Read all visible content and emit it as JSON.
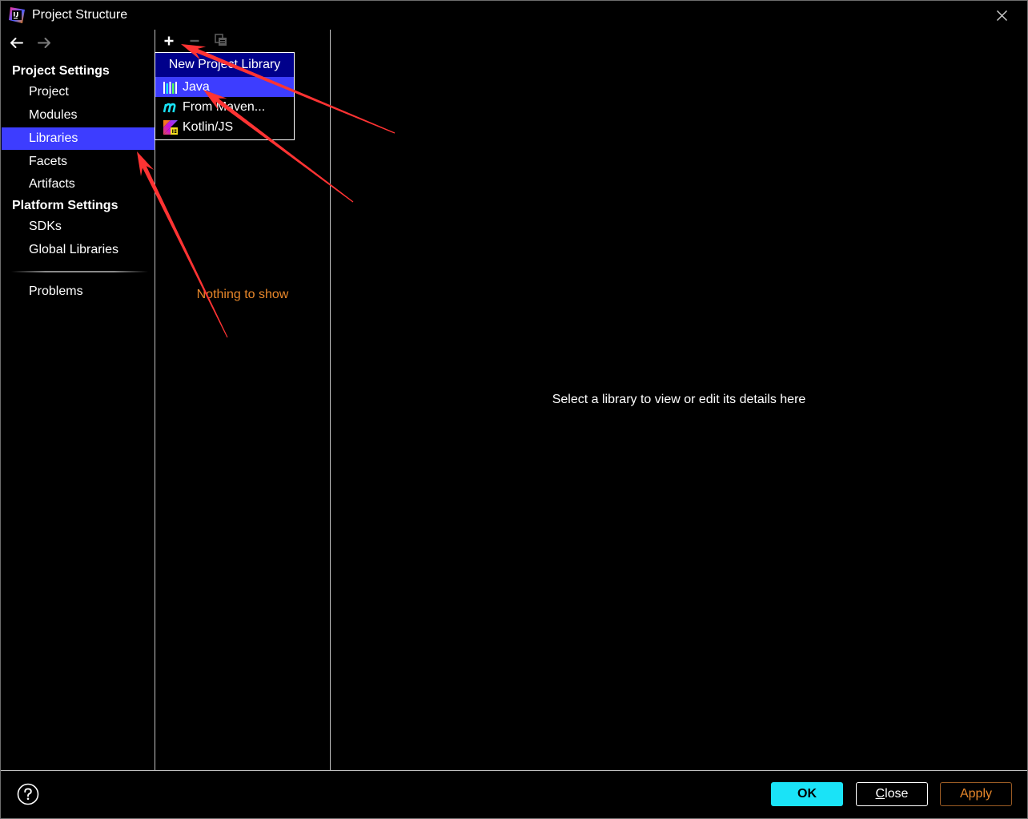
{
  "window": {
    "title": "Project Structure",
    "app_icon": "intellij-idea-icon",
    "close_icon": "close-icon"
  },
  "navigation": {
    "back_icon": "arrow-left-icon",
    "forward_icon": "arrow-right-icon",
    "back_enabled": true,
    "forward_enabled": false
  },
  "sidebar": {
    "project_settings": {
      "heading": "Project Settings",
      "items": [
        {
          "label": "Project",
          "selected": false
        },
        {
          "label": "Modules",
          "selected": false
        },
        {
          "label": "Libraries",
          "selected": true
        },
        {
          "label": "Facets",
          "selected": false
        },
        {
          "label": "Artifacts",
          "selected": false
        }
      ]
    },
    "platform_settings": {
      "heading": "Platform Settings",
      "items": [
        {
          "label": "SDKs",
          "selected": false
        },
        {
          "label": "Global Libraries",
          "selected": false
        }
      ]
    },
    "other_items": [
      {
        "label": "Problems",
        "selected": false
      }
    ]
  },
  "libraries_panel": {
    "toolbar": {
      "add_icon": "plus-icon",
      "remove_icon": "minus-icon",
      "copy_icon": "copy-icon",
      "add_enabled": true,
      "remove_enabled": false,
      "copy_enabled": false
    },
    "empty_text": "Nothing to show",
    "new_library_popup": {
      "header": "New Project Library",
      "items": [
        {
          "label": "Java",
          "icon": "library-icon",
          "selected": true
        },
        {
          "label": "From Maven...",
          "icon": "maven-icon",
          "selected": false
        },
        {
          "label": "Kotlin/JS",
          "icon": "kotlin-js-icon",
          "selected": false
        }
      ]
    }
  },
  "details_panel": {
    "placeholder": "Select a library to view or edit its details here"
  },
  "footer": {
    "help_icon": "help-icon",
    "ok_label": "OK",
    "close_label": "Close",
    "apply_label": "Apply"
  },
  "colors": {
    "background": "#000000",
    "text": "#ffffff",
    "selection": "#3d3dff",
    "popup_header": "#00008b",
    "empty_text": "#e8872a",
    "ok_button": "#1ae3f7",
    "apply_border": "#9a5b24",
    "apply_text": "#e8872a",
    "divider": "#c0c0c0",
    "disabled_icon": "#5a5a5a",
    "annotation_arrow": "#ff3333"
  }
}
